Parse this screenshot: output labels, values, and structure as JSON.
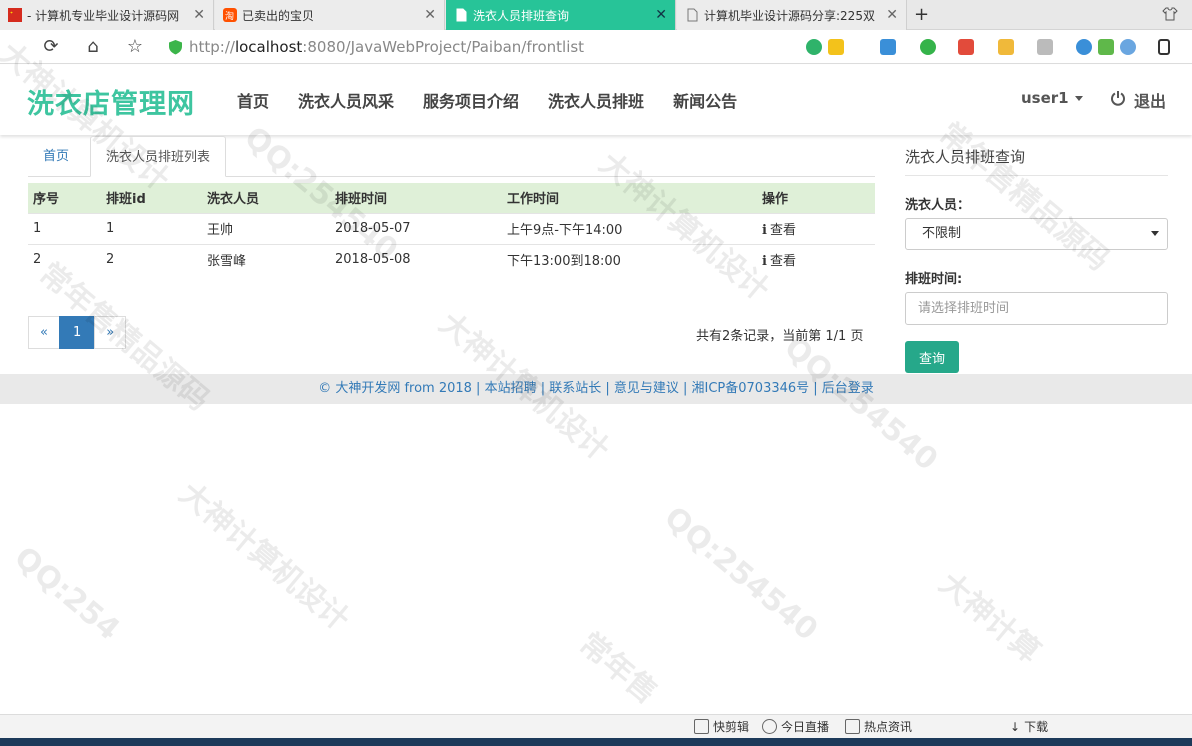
{
  "browser": {
    "tabs": [
      {
        "label": "- 计算机专业毕业设计源码网",
        "icon": "cn-flag-icon",
        "active": false
      },
      {
        "label": "已卖出的宝贝",
        "icon": "taobao-icon",
        "active": false
      },
      {
        "label": "洗衣人员排班查询",
        "icon": "page-icon",
        "active": true
      },
      {
        "label": "计算机毕业设计源码分享:225双",
        "icon": "page-icon",
        "active": false
      }
    ],
    "url_prefix": "http://",
    "url_host": "localhost",
    "url_rest": ":8080/JavaWebProject/Paiban/frontlist",
    "tab_close": "✕",
    "new_tab": "+"
  },
  "site": {
    "logo": "洗衣店管理网",
    "nav": [
      "首页",
      "洗衣人员风采",
      "服务项目介绍",
      "洗衣人员排班",
      "新闻公告"
    ],
    "user": "user1",
    "logout": "退出"
  },
  "breadcrumb": {
    "home": "首页",
    "current": "洗衣人员排班列表"
  },
  "table": {
    "headers": [
      "序号",
      "排班id",
      "洗衣人员",
      "排班时间",
      "工作时间",
      "操作"
    ],
    "rows": [
      {
        "no": "1",
        "id": "1",
        "staff": "王帅",
        "date": "2018-05-07",
        "hours": "上午9点-下午14:00",
        "action": "查看"
      },
      {
        "no": "2",
        "id": "2",
        "staff": "张雪峰",
        "date": "2018-05-08",
        "hours": "下午13:00到18:00",
        "action": "查看"
      }
    ]
  },
  "pager": {
    "prev": "«",
    "page": "1",
    "next": "»",
    "summary": "共有2条记录，当前第 1/1 页"
  },
  "footer": "© 大神开发网 from 2018 | 本站招聘 | 联系站长 | 意见与建议 | 湘ICP备0703346号 | 后台登录",
  "sidebar": {
    "title": "洗衣人员排班查询",
    "staff_label": "洗衣人员：",
    "staff_value": "不限制",
    "date_label": "排班时间:",
    "date_placeholder": "请选择排班时间",
    "search": "查询"
  },
  "statusbar": [
    "快剪辑",
    "今日直播",
    "热点资讯",
    "下载"
  ],
  "colors": {
    "accent": "#3ec5a0",
    "active_tab": "#27c498",
    "link": "#337ab7",
    "table_header": "#dff0d8",
    "button": "#26a88a"
  }
}
